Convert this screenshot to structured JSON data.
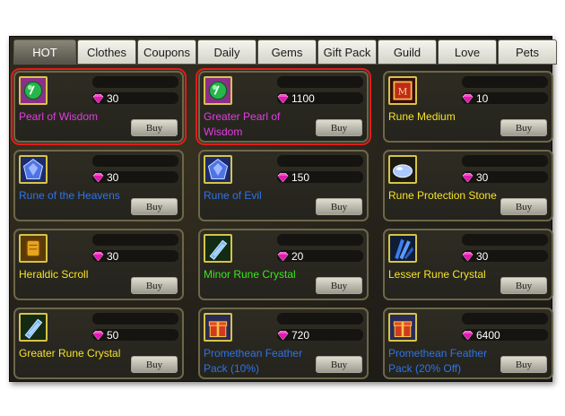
{
  "tabs": [
    {
      "label": "HOT",
      "active": true
    },
    {
      "label": "Clothes"
    },
    {
      "label": "Coupons"
    },
    {
      "label": "Daily"
    },
    {
      "label": "Gems"
    },
    {
      "label": "Gift Pack"
    },
    {
      "label": "Guild"
    },
    {
      "label": "Love"
    },
    {
      "label": "Pets"
    }
  ],
  "buy_label": "Buy",
  "items": [
    {
      "name": "Pearl of Wisdom",
      "price": "30",
      "name_color": "#e43ce3",
      "icon": "green-pearl-icon",
      "selected": true
    },
    {
      "name": "Greater Pearl of Wisdom",
      "price": "1100",
      "name_color": "#e43ce3",
      "icon": "green-pearl-icon",
      "selected": true
    },
    {
      "name": "Rune Medium",
      "price": "10",
      "name_color": "#f6e22a",
      "icon": "rune-medium-icon"
    },
    {
      "name": "Rune of the Heavens",
      "price": "30",
      "name_color": "#2f74e8",
      "icon": "blue-rune-stone-icon"
    },
    {
      "name": "Rune of Evil",
      "price": "150",
      "name_color": "#2f74e8",
      "icon": "blue-rune-stone-icon"
    },
    {
      "name": "Rune Protection Stone",
      "price": "30",
      "name_color": "#f6e22a",
      "icon": "protection-stone-icon"
    },
    {
      "name": "Heraldic Scroll",
      "price": "30",
      "name_color": "#f6e22a",
      "icon": "scroll-icon"
    },
    {
      "name": "Minor Rune Crystal",
      "price": "20",
      "name_color": "#39e81f",
      "icon": "crystal-icon"
    },
    {
      "name": "Lesser Rune Crystal",
      "price": "30",
      "name_color": "#f6e22a",
      "icon": "crystal-cluster-icon"
    },
    {
      "name": "Greater Rune Crystal",
      "price": "50",
      "name_color": "#f6e22a",
      "icon": "crystal-icon"
    },
    {
      "name": "Promethean Feather Pack (10%)",
      "price": "720",
      "name_color": "#2f74e8",
      "icon": "gift-box-icon"
    },
    {
      "name": "Promethean Feather Pack (20% Off)",
      "price": "6400",
      "name_color": "#2f74e8",
      "icon": "gift-box-icon"
    }
  ]
}
